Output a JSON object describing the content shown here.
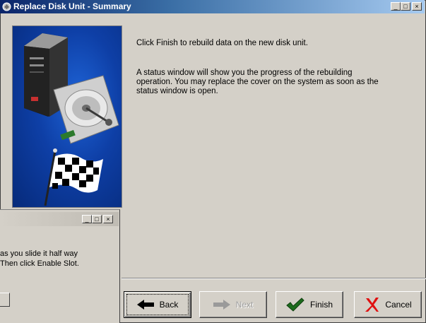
{
  "window": {
    "title": "Replace Disk Unit - Summary",
    "controls": [
      "_",
      "□",
      "×"
    ]
  },
  "content": {
    "paragraph1": "Click Finish to rebuild data on the new disk unit.",
    "paragraph2_lines": [
      "A status window will show you the progress of the rebuilding",
      "operation. You may replace the cover on the system as soon as the",
      "status window is open."
    ]
  },
  "buttons": {
    "back": {
      "label": "Back",
      "icon": "arrow-left-icon",
      "enabled": true
    },
    "next": {
      "label": "Next",
      "icon": "arrow-right-icon",
      "enabled": false
    },
    "finish": {
      "label": "Finish",
      "icon": "checkmark-icon",
      "enabled": true
    },
    "cancel": {
      "label": "Cancel",
      "icon": "red-x-icon",
      "enabled": true
    }
  },
  "background_window": {
    "controls": [
      "_",
      "□",
      "×"
    ],
    "text_lines": [
      "as you slide it half way",
      "Then click Enable Slot."
    ]
  },
  "illustration": {
    "subjects": [
      "server-tower",
      "hard-disk",
      "checkered-flag"
    ]
  }
}
